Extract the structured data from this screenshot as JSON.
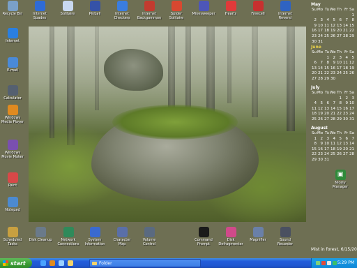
{
  "desktop": {
    "top_icons": [
      {
        "label": "Recycle Bin",
        "icon": "recycle-bin-icon",
        "color": "#7aa0c8"
      },
      {
        "label": "Internet Spades",
        "icon": "spades-icon",
        "color": "#2f6bd6"
      },
      {
        "label": "Solitaire",
        "icon": "cards-icon",
        "color": "#c8d8f0"
      },
      {
        "label": "Pinball",
        "icon": "pinball-icon",
        "color": "#3552a8"
      },
      {
        "label": "Internet Checkers",
        "icon": "checkers-icon",
        "color": "#3a7de0"
      },
      {
        "label": "Internet Backgammon",
        "icon": "backgammon-icon",
        "color": "#c23b2f"
      },
      {
        "label": "Spider Solitaire",
        "icon": "spider-icon",
        "color": "#d84830"
      },
      {
        "label": "Minesweeper",
        "icon": "mine-icon",
        "color": "#4d56b8"
      },
      {
        "label": "Hearts",
        "icon": "heart-icon",
        "color": "#e03a3a"
      },
      {
        "label": "Freecell",
        "icon": "freecell-icon",
        "color": "#c8302f"
      },
      {
        "label": "Internet Reversi",
        "icon": "reversi-icon",
        "color": "#2f63c2"
      }
    ],
    "left_icons": [
      {
        "label": "Internet",
        "icon": "internet-explorer-icon",
        "color": "#2a7fe0"
      },
      {
        "label": "E-mail",
        "icon": "email-icon",
        "color": "#4a8ad8"
      },
      {
        "label": "Calculator",
        "icon": "calculator-icon",
        "color": "#556070"
      },
      {
        "label": "Windows Media Player",
        "icon": "media-player-icon",
        "color": "#e08a20"
      },
      {
        "label": "Windows Movie Maker",
        "icon": "movie-maker-icon",
        "color": "#7a4fb0"
      },
      {
        "label": "Paint",
        "icon": "paint-icon",
        "color": "#d84848"
      },
      {
        "label": "Notepad",
        "icon": "notepad-icon",
        "color": "#4c8ad0"
      },
      {
        "label": "Scheduled Tasks",
        "icon": "scheduled-tasks-icon",
        "color": "#c8a040"
      }
    ],
    "bottom_icons": [
      {
        "label": "Disk Cleanup",
        "icon": "disk-cleanup-icon",
        "color": "#6a7a8a"
      },
      {
        "label": "Network Connections",
        "icon": "network-icon",
        "color": "#2f8a5a"
      },
      {
        "label": "System Information",
        "icon": "system-info-icon",
        "color": "#3a6ad0"
      },
      {
        "label": "Character Map",
        "icon": "character-map-icon",
        "color": "#5a6fa8"
      },
      {
        "label": "Volume Control",
        "icon": "volume-icon",
        "color": "#5a6a80"
      },
      {
        "label": "Command Prompt",
        "icon": "command-prompt-icon",
        "color": "#1a1a1a"
      },
      {
        "label": "Disk Defragmenter",
        "icon": "defragmenter-icon",
        "color": "#d04a8a"
      },
      {
        "label": "Magnifier",
        "icon": "magnifier-icon",
        "color": "#6a80a8"
      },
      {
        "label": "Sound Recorder",
        "icon": "sound-recorder-icon",
        "color": "#4a5060"
      }
    ],
    "right_icon": {
      "label": "Nicely Manager",
      "icon": "manager-icon",
      "color": "#2f8a3a"
    },
    "wallpaper_caption": "Mist in forest, 6/15/2004"
  },
  "calendar": [
    {
      "month": "May",
      "highlight": false,
      "headers": [
        "Su",
        "Mo",
        "Tu",
        "We",
        "Th",
        "Fr",
        "Sa"
      ],
      "days": [
        "",
        "",
        "",
        "",
        "",
        "",
        "1",
        "2",
        "3",
        "4",
        "5",
        "6",
        "7",
        "8",
        "9",
        "10",
        "11",
        "12",
        "13",
        "14",
        "15",
        "16",
        "17",
        "18",
        "19",
        "20",
        "21",
        "22",
        "23",
        "24",
        "25",
        "26",
        "27",
        "28",
        "29",
        "30",
        "31",
        "",
        "",
        "",
        "",
        ""
      ]
    },
    {
      "month": "June",
      "highlight": true,
      "headers": [
        "Su",
        "Mo",
        "Tu",
        "We",
        "Th",
        "Fr",
        "Sa"
      ],
      "days": [
        "",
        "",
        "1",
        "2",
        "3",
        "4",
        "5",
        "6",
        "7",
        "8",
        "9",
        "10",
        "11",
        "12",
        "13",
        "14",
        "15",
        "16",
        "17",
        "18",
        "19",
        "20",
        "21",
        "22",
        "23",
        "24",
        "25",
        "26",
        "27",
        "28",
        "29",
        "30",
        "",
        "",
        ""
      ]
    },
    {
      "month": "July",
      "highlight": false,
      "headers": [
        "Su",
        "Mo",
        "Tu",
        "We",
        "Th",
        "Fr",
        "Sa"
      ],
      "days": [
        "",
        "",
        "",
        "",
        "1",
        "2",
        "3",
        "4",
        "5",
        "6",
        "7",
        "8",
        "9",
        "10",
        "11",
        "12",
        "13",
        "14",
        "15",
        "16",
        "17",
        "18",
        "19",
        "20",
        "21",
        "22",
        "23",
        "24",
        "25",
        "26",
        "27",
        "28",
        "29",
        "30",
        "31"
      ]
    },
    {
      "month": "August",
      "highlight": false,
      "headers": [
        "Su",
        "Mo",
        "Tu",
        "We",
        "Th",
        "Fr",
        "Sa"
      ],
      "days": [
        "1",
        "2",
        "3",
        "4",
        "5",
        "6",
        "7",
        "8",
        "9",
        "10",
        "11",
        "12",
        "13",
        "14",
        "15",
        "16",
        "17",
        "18",
        "19",
        "20",
        "21",
        "22",
        "23",
        "24",
        "25",
        "26",
        "27",
        "28",
        "29",
        "30",
        "31",
        "",
        "",
        "",
        ""
      ]
    }
  ],
  "taskbar": {
    "start_label": "start",
    "window_label": "Folder",
    "clock": "5:29 PM",
    "quick_launch": [
      {
        "icon": "ie-quicklaunch-icon",
        "color": "#4aa3ff"
      },
      {
        "icon": "media-quicklaunch-icon",
        "color": "#e08a20"
      },
      {
        "icon": "desktop-quicklaunch-icon",
        "color": "#9ad0ff"
      },
      {
        "icon": "folder-quicklaunch-icon",
        "color": "#f2d36b"
      }
    ],
    "tray_icons": [
      {
        "icon": "network-tray-icon",
        "color": "#7fd07a"
      },
      {
        "icon": "security-tray-icon",
        "color": "#e04a3a"
      },
      {
        "icon": "volume-tray-icon",
        "color": "#e8e8e8"
      },
      {
        "icon": "messenger-tray-icon",
        "color": "#3ac06a"
      }
    ]
  }
}
